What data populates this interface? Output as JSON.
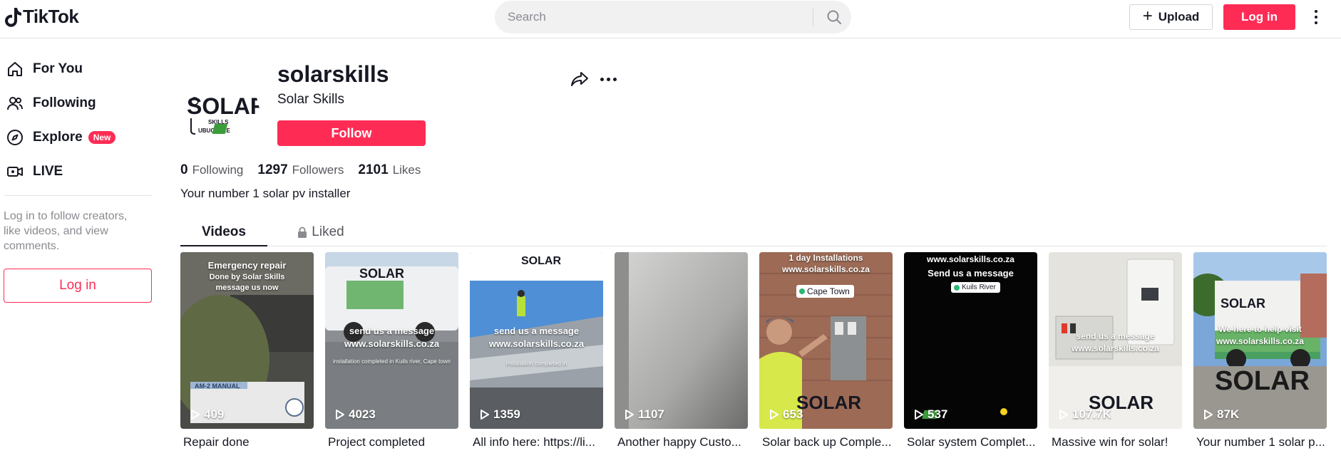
{
  "header": {
    "logo_text": "TikTok",
    "search_placeholder": "Search",
    "upload_label": "Upload",
    "login_label": "Log in"
  },
  "sidebar": {
    "items": [
      {
        "label": "For You",
        "icon": "home-icon"
      },
      {
        "label": "Following",
        "icon": "users-icon"
      },
      {
        "label": "Explore",
        "icon": "compass-icon",
        "badge": "New"
      },
      {
        "label": "LIVE",
        "icon": "live-icon"
      }
    ],
    "note": "Log in to follow creators, like videos, and view comments.",
    "login_label": "Log in"
  },
  "profile": {
    "username": "solarskills",
    "nickname": "Solar Skills",
    "follow_label": "Follow",
    "following_count": "0",
    "following_label": "Following",
    "followers_count": "1297",
    "followers_label": "Followers",
    "likes_count": "2101",
    "likes_label": "Likes",
    "bio": "Your number 1 solar pv installer",
    "avatar_logo": {
      "word": "SOLAR",
      "sub1": "SKILLS",
      "sub2": "UBUCHULE"
    }
  },
  "tabs": {
    "videos": "Videos",
    "liked": "Liked"
  },
  "videos": [
    {
      "views": "409",
      "caption": "Repair done",
      "overlay": [
        "Emergency repair",
        "Done by Solar Skills",
        "message us now"
      ],
      "extra": "AM-2 MANUAL"
    },
    {
      "views": "4023",
      "caption": "Project completed",
      "overlay": [
        "send us a message",
        "www.solarskills.co.za"
      ],
      "extra": "installation completed in Kuils river, Cape town"
    },
    {
      "views": "1359",
      "caption": "All info here: https://li...",
      "overlay": [
        "send us a message",
        "www.solarskills.co.za"
      ],
      "extra": "installation completed in"
    },
    {
      "views": "1107",
      "caption": "Another happy Custo...",
      "overlay": []
    },
    {
      "views": "653",
      "caption": "Solar back up Comple...",
      "overlay": [
        "1 day Installations",
        "www.solarskills.co.za"
      ],
      "location": "Cape Town"
    },
    {
      "views": "537",
      "caption": "Solar system Complet...",
      "overlay": [
        "www.solarskills.co.za",
        "Send us a message"
      ],
      "location": "Kuils River"
    },
    {
      "views": "107.7K",
      "caption": "Massive win for solar!",
      "overlay": [
        "send us a message",
        "www.solarskills.co.za"
      ]
    },
    {
      "views": "87K",
      "caption": "Your number 1 solar p...",
      "overlay": [
        "We here to help visit",
        "www.solarskills.co.za"
      ]
    }
  ],
  "colors": {
    "accent": "#fe2c55",
    "text": "#161823",
    "muted": "#8a8b91",
    "logo_green": "#3a9d3a"
  }
}
